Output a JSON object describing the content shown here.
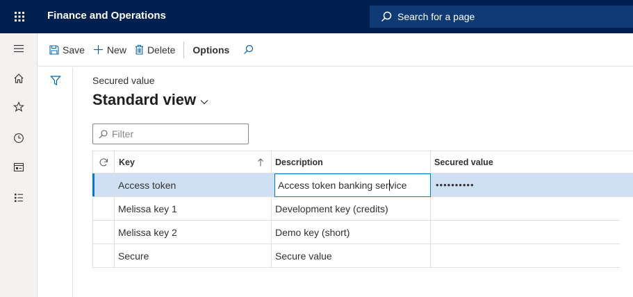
{
  "app": {
    "title": "Finance and Operations",
    "search_placeholder": "Search for a page"
  },
  "navrail": {
    "items": [
      {
        "name": "waffle",
        "icon": "waffle-icon"
      },
      {
        "name": "menu",
        "icon": "hamburger-icon"
      },
      {
        "name": "home",
        "icon": "home-icon"
      },
      {
        "name": "favorites",
        "icon": "star-icon"
      },
      {
        "name": "recent",
        "icon": "clock-icon"
      },
      {
        "name": "workspaces",
        "icon": "workspace-icon"
      },
      {
        "name": "modules",
        "icon": "list-icon"
      }
    ]
  },
  "actionpane": {
    "save_label": "Save",
    "new_label": "New",
    "delete_label": "Delete",
    "options_label": "Options"
  },
  "page": {
    "caption": "Secured value",
    "view_title": "Standard view",
    "filter_placeholder": "Filter"
  },
  "grid": {
    "columns": [
      "Key",
      "Description",
      "Secured value"
    ],
    "rows": [
      {
        "key": "Access token",
        "description_before_caret": "Access token banking ser",
        "description_after_caret": "vice",
        "secured": "••••••••••",
        "selected": true
      },
      {
        "key": "Melissa key 1",
        "description": "Development key (credits)",
        "secured": ""
      },
      {
        "key": "Melissa key 2",
        "description": "Demo key (short)",
        "secured": ""
      },
      {
        "key": "Secure",
        "description": "Secure value",
        "secured": ""
      }
    ]
  },
  "colors": {
    "topbar": "#002050",
    "accent": "#0078d4",
    "selected_row": "#cfe0f4"
  }
}
